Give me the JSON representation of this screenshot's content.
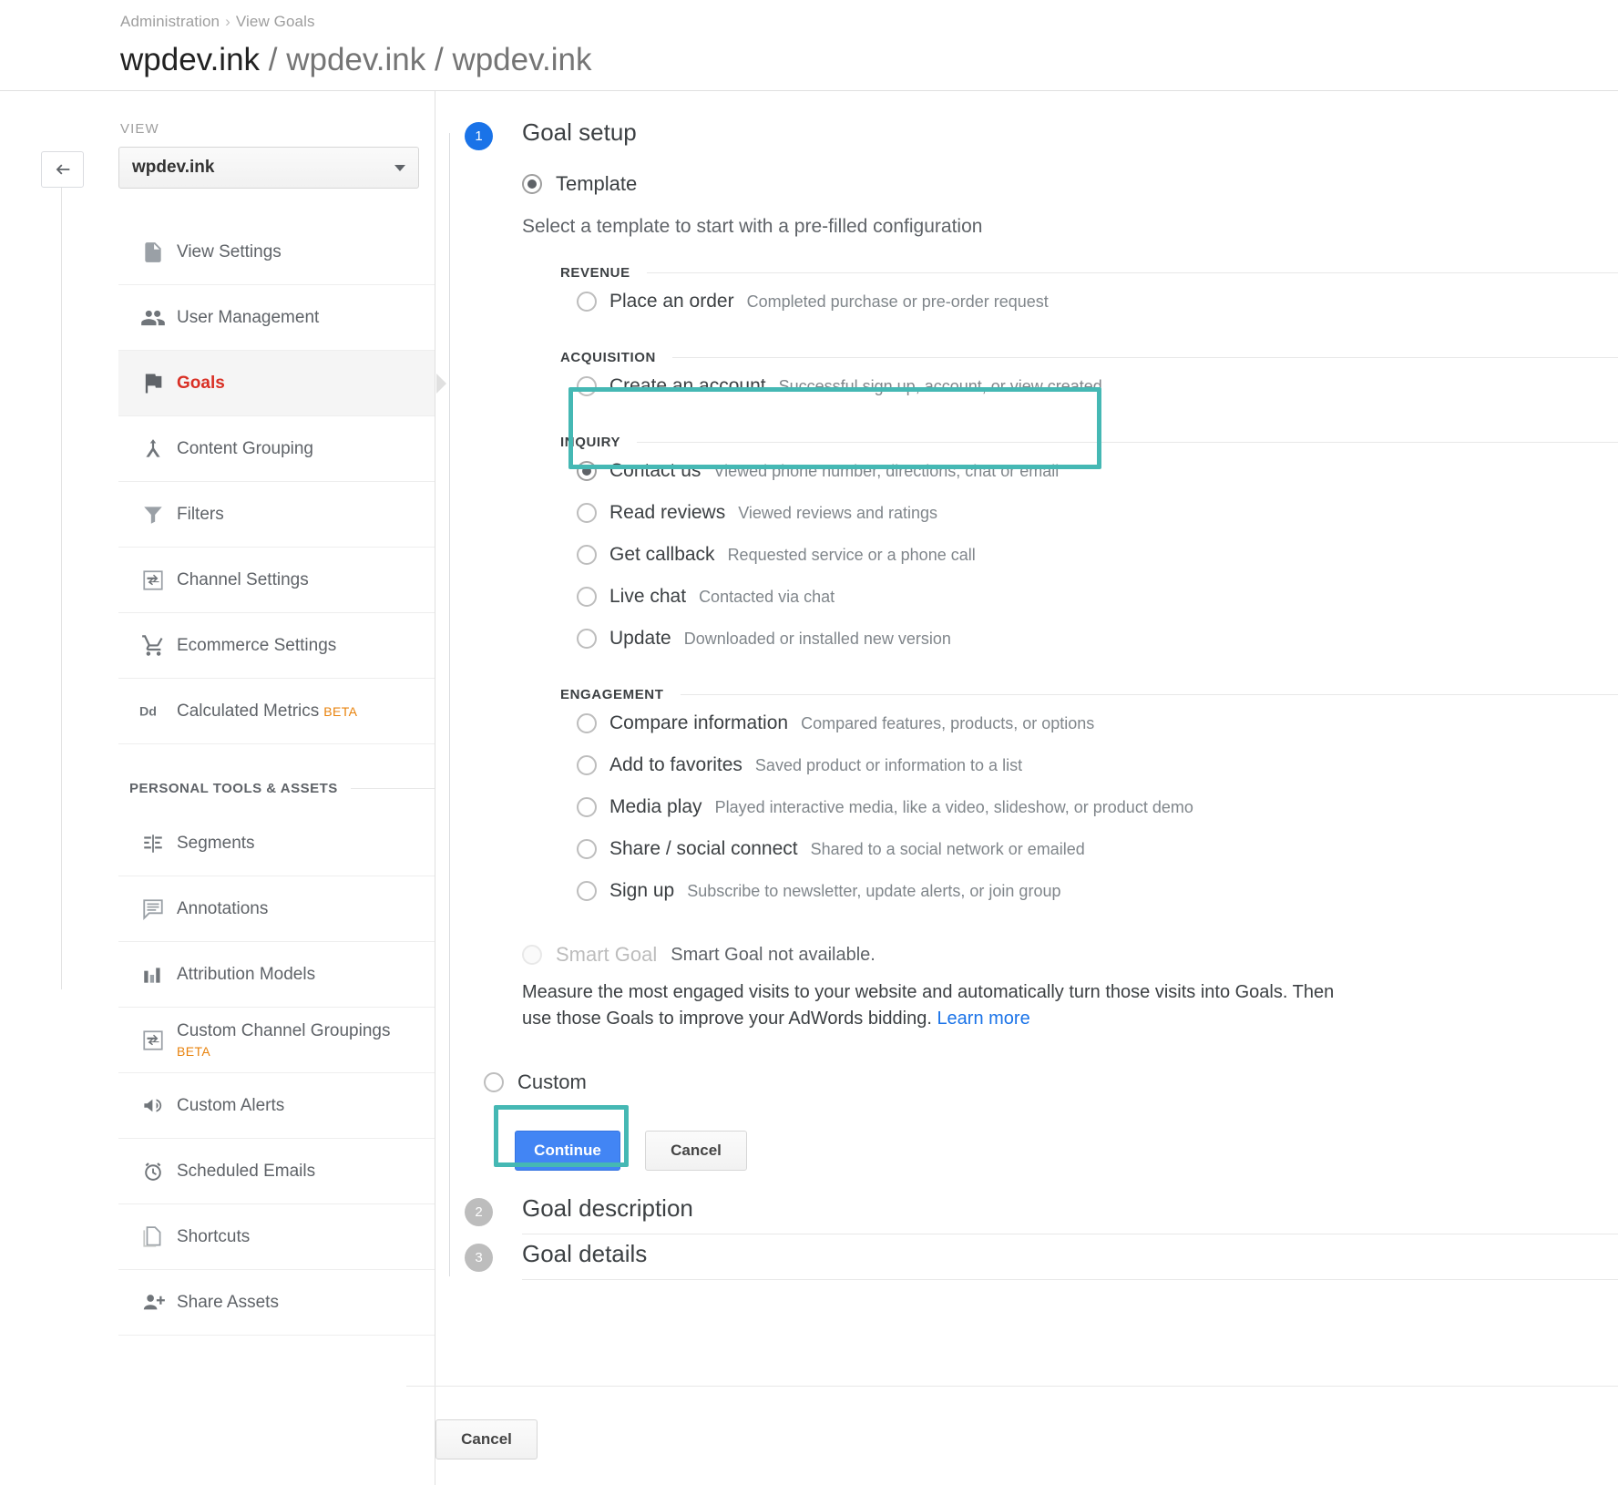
{
  "header": {
    "breadcrumb": [
      "Administration",
      "View Goals"
    ],
    "breadcrumb_separator": "›",
    "title_strong": "wpdev.ink",
    "title_rest": "/ wpdev.ink / wpdev.ink"
  },
  "sidebar": {
    "view_label": "VIEW",
    "view_selected": "wpdev.ink",
    "items": [
      {
        "label": "View Settings",
        "icon": "document-icon",
        "active": false
      },
      {
        "label": "User Management",
        "icon": "people-icon",
        "active": false
      },
      {
        "label": "Goals",
        "icon": "flag-icon",
        "active": true
      },
      {
        "label": "Content Grouping",
        "icon": "content-grouping-icon",
        "active": false
      },
      {
        "label": "Filters",
        "icon": "funnel-icon",
        "active": false
      },
      {
        "label": "Channel Settings",
        "icon": "channel-settings-icon",
        "active": false
      },
      {
        "label": "Ecommerce Settings",
        "icon": "shopping-cart-icon",
        "active": false
      },
      {
        "label": "Calculated Metrics",
        "badge": "BETA",
        "icon": "dd-icon",
        "active": false
      }
    ],
    "personal_section_title": "PERSONAL TOOLS & ASSETS",
    "personal_items": [
      {
        "label": "Segments",
        "icon": "segments-icon"
      },
      {
        "label": "Annotations",
        "icon": "annotation-icon"
      },
      {
        "label": "Attribution Models",
        "icon": "bar-chart-icon"
      },
      {
        "label": "Custom Channel Groupings",
        "badge": "BETA",
        "icon": "channel-settings-icon"
      },
      {
        "label": "Custom Alerts",
        "icon": "megaphone-icon"
      },
      {
        "label": "Scheduled Emails",
        "icon": "alarm-clock-icon"
      },
      {
        "label": "Shortcuts",
        "icon": "copies-icon"
      },
      {
        "label": "Share Assets",
        "icon": "person-add-icon"
      }
    ]
  },
  "main": {
    "step1": {
      "number": "1",
      "title": "Goal setup",
      "template_option": "Template",
      "template_hint": "Select a template to start with a pre-filled configuration",
      "groups": [
        {
          "name": "REVENUE",
          "options": [
            {
              "name": "Place an order",
              "desc": "Completed purchase or pre-order request",
              "selected": false
            }
          ]
        },
        {
          "name": "ACQUISITION",
          "options": [
            {
              "name": "Create an account",
              "desc": "Successful sign up, account, or view created",
              "selected": false
            }
          ]
        },
        {
          "name": "INQUIRY",
          "highlighted": true,
          "options": [
            {
              "name": "Contact us",
              "desc": "Viewed phone number, directions, chat or email",
              "selected": true
            },
            {
              "name": "Read reviews",
              "desc": "Viewed reviews and ratings",
              "selected": false
            },
            {
              "name": "Get callback",
              "desc": "Requested service or a phone call",
              "selected": false
            },
            {
              "name": "Live chat",
              "desc": "Contacted via chat",
              "selected": false
            },
            {
              "name": "Update",
              "desc": "Downloaded or installed new version",
              "selected": false
            }
          ]
        },
        {
          "name": "ENGAGEMENT",
          "options": [
            {
              "name": "Compare information",
              "desc": "Compared features, products, or options",
              "selected": false
            },
            {
              "name": "Add to favorites",
              "desc": "Saved product or information to a list",
              "selected": false
            },
            {
              "name": "Media play",
              "desc": "Played interactive media, like a video, slideshow, or product demo",
              "selected": false
            },
            {
              "name": "Share / social connect",
              "desc": "Shared to a social network or emailed",
              "selected": false
            },
            {
              "name": "Sign up",
              "desc": "Subscribe to newsletter, update alerts, or join group",
              "selected": false
            }
          ]
        }
      ],
      "smart_goal": {
        "label": "Smart Goal",
        "note": "Smart Goal not available.",
        "description": "Measure the most engaged visits to your website and automatically turn those visits into Goals. Then use those Goals to improve your AdWords bidding.",
        "learn_more": "Learn more"
      },
      "custom_option": "Custom",
      "continue_label": "Continue",
      "cancel_label": "Cancel"
    },
    "step2": {
      "number": "2",
      "title": "Goal description"
    },
    "step3": {
      "number": "3",
      "title": "Goal details"
    },
    "footer_cancel": "Cancel"
  },
  "colors": {
    "highlight_teal": "#45b8b4",
    "primary_blue": "#4285f4",
    "badge_blue": "#1a73e8",
    "active_red": "#d93025",
    "beta_orange": "#e8820c",
    "link_blue": "#1a73e8"
  }
}
